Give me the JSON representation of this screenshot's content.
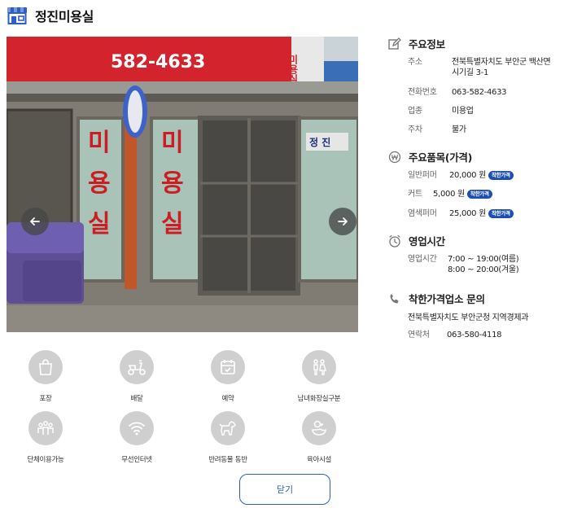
{
  "store": {
    "name": "정진미용실"
  },
  "photo": {
    "sign_phone": "582-4633",
    "sign_suffix": "미용실",
    "window_text_left": [
      "미",
      "용",
      "실"
    ],
    "window_text_right": [
      "미",
      "용",
      "실"
    ],
    "window_sticker": "정 진"
  },
  "amenities": [
    {
      "label": "포장",
      "icon": "takeout-bag-icon"
    },
    {
      "label": "배달",
      "icon": "delivery-scooter-icon"
    },
    {
      "label": "예약",
      "icon": "calendar-check-icon"
    },
    {
      "label": "남녀화장실구분",
      "icon": "restroom-icon"
    },
    {
      "label": "단체이용가능",
      "icon": "group-icon"
    },
    {
      "label": "무선인터넷",
      "icon": "wifi-icon"
    },
    {
      "label": "반려동물 동반",
      "icon": "pet-dog-icon"
    },
    {
      "label": "육아시설",
      "icon": "baby-duck-icon"
    }
  ],
  "close_label": "닫기",
  "info": {
    "main": {
      "title": "주요정보",
      "address_label": "주소",
      "address_line1": "전북특별자치도 부안군 백산면",
      "address_line2": "시기길 3-1",
      "phone_label": "전화번호",
      "phone": "063-582-4633",
      "category_label": "업종",
      "category": "미용업",
      "parking_label": "주차",
      "parking": "불가"
    },
    "items": {
      "title": "주요품목(가격)",
      "badge": "착한가격",
      "list": [
        {
          "name": "일반퍼머",
          "price": "20,000 원"
        },
        {
          "name": "커트",
          "price": "5,000 원"
        },
        {
          "name": "염색퍼머",
          "price": "25,000 원"
        }
      ]
    },
    "hours": {
      "title": "영업시간",
      "label": "영업시간",
      "line1": "7:00 ~ 19:00(여름)",
      "line2": "8:00 ~ 20:00(겨울)"
    },
    "contact": {
      "title": "착한가격업소 문의",
      "org": "전북특별자치도 부안군청 지역경제과",
      "phone_label": "연락처",
      "phone": "063-580-4118"
    }
  }
}
